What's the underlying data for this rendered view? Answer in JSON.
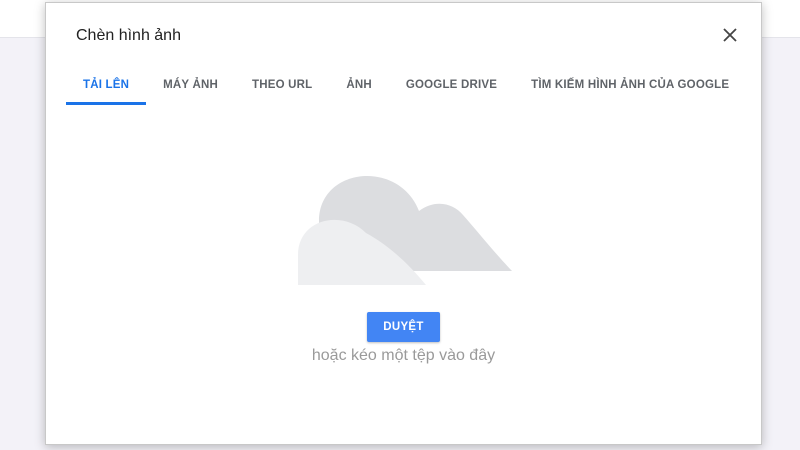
{
  "dialog": {
    "title": "Chèn hình ảnh",
    "close_icon": "close-icon"
  },
  "tabs": [
    {
      "label": "TẢI LÊN",
      "active": true
    },
    {
      "label": "MÁY ẢNH",
      "active": false
    },
    {
      "label": "THEO URL",
      "active": false
    },
    {
      "label": "ẢNH",
      "active": false
    },
    {
      "label": "GOOGLE DRIVE",
      "active": false
    },
    {
      "label": "TÌM KIẾM HÌNH ẢNH CỦA GOOGLE",
      "active": false
    }
  ],
  "upload": {
    "illustration_icon": "cloud-icon",
    "browse_label": "DUYỆT",
    "drop_hint": "hoặc kéo một tệp vào đây"
  },
  "colors": {
    "accent": "#1a73e8",
    "button": "#4285f4",
    "cloud_back": "#dcdde0",
    "cloud_front": "#eeeff1"
  }
}
